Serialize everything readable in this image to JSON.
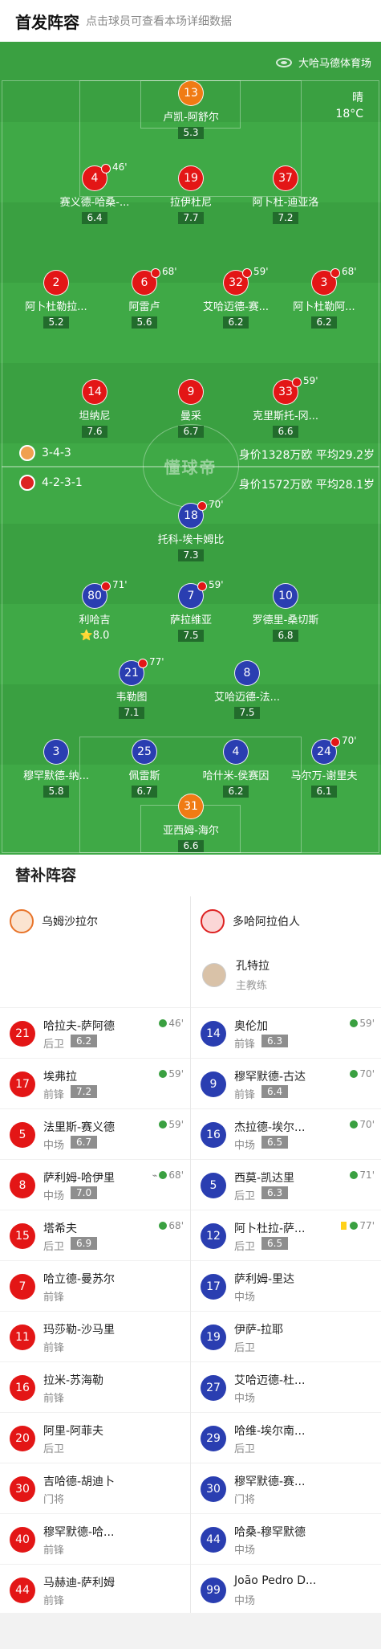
{
  "header": {
    "title": "首发阵容",
    "hint": "点击球员可查看本场详细数据"
  },
  "match": {
    "venue": "大哈马德体育场",
    "weather": "晴",
    "temperature": "18°C"
  },
  "home": {
    "formation": "3-4-3",
    "stats": "身价1328万欧  平均29.2岁",
    "color": "#e31616",
    "players": [
      {
        "num": "13",
        "name": "卢凯-阿舒尔",
        "rating": "5.3",
        "keeper": true
      },
      {
        "num": "4",
        "name": "赛义德-哈桑-...",
        "rating": "6.4",
        "sub": "46'"
      },
      {
        "num": "19",
        "name": "拉伊杜尼",
        "rating": "7.7",
        "ball": true
      },
      {
        "num": "37",
        "name": "阿卜杜-迪亚洛",
        "rating": "7.2"
      },
      {
        "num": "2",
        "name": "阿卜杜勒拉...",
        "rating": "5.2",
        "red": true
      },
      {
        "num": "6",
        "name": "阿雷卢",
        "rating": "5.6",
        "sub": "68'"
      },
      {
        "num": "32",
        "name": "艾哈迈德-赛...",
        "rating": "6.2",
        "sub": "59'"
      },
      {
        "num": "3",
        "name": "阿卜杜勒阿...",
        "rating": "6.2",
        "sub": "68'"
      },
      {
        "num": "14",
        "name": "坦纳尼",
        "rating": "7.6",
        "yellow": true,
        "captain": "C"
      },
      {
        "num": "9",
        "name": "曼采",
        "rating": "6.7",
        "ball": true
      },
      {
        "num": "33",
        "name": "克里斯托-冈...",
        "rating": "6.6",
        "sub": "59'"
      }
    ]
  },
  "away": {
    "formation": "4-2-3-1",
    "stats": "身价1572万欧  平均28.1岁",
    "color": "#2a3eb1",
    "players": [
      {
        "num": "18",
        "name": "托科-埃卡姆比",
        "rating": "7.3",
        "sub": "70'"
      },
      {
        "num": "80",
        "name": "利哈吉",
        "rating": "8.0",
        "sub": "71'",
        "best": true
      },
      {
        "num": "7",
        "name": "萨拉维亚",
        "rating": "7.5",
        "sub": "59'"
      },
      {
        "num": "10",
        "name": "罗德里-桑切斯",
        "rating": "6.8"
      },
      {
        "num": "21",
        "name": "韦勒图",
        "rating": "7.1",
        "sub": "77'"
      },
      {
        "num": "8",
        "name": "艾哈迈德-法...",
        "rating": "7.5",
        "captain": "C"
      },
      {
        "num": "3",
        "name": "穆罕默德-纳...",
        "rating": "5.8",
        "yellow": true
      },
      {
        "num": "25",
        "name": "佩雷斯",
        "rating": "6.7"
      },
      {
        "num": "4",
        "name": "哈什米-侯赛因",
        "rating": "6.2",
        "red": true
      },
      {
        "num": "24",
        "name": "马尔万-谢里夫",
        "rating": "6.1",
        "sub": "70'"
      },
      {
        "num": "31",
        "name": "亚西姆-海尔",
        "rating": "6.6",
        "keeper": true
      }
    ]
  },
  "center_logo": "懂球帝",
  "subs": {
    "title": "替补阵容",
    "home_team": "乌姆沙拉尔",
    "away_team": "多哈阿拉伯人",
    "coach": {
      "name": "孔特拉",
      "role": "主教练"
    },
    "home": [
      {
        "num": "21",
        "name": "哈拉夫-萨阿德",
        "pos": "后卫",
        "rating": "6.2",
        "time": "46'"
      },
      {
        "num": "17",
        "name": "埃弗拉",
        "pos": "前锋",
        "rating": "7.2",
        "time": "59'"
      },
      {
        "num": "5",
        "name": "法里斯-赛义德",
        "pos": "中场",
        "rating": "6.7",
        "time": "59'"
      },
      {
        "num": "8",
        "name": "萨利姆-哈伊里",
        "pos": "中场",
        "rating": "7.0",
        "time": "68'",
        "boot": true
      },
      {
        "num": "15",
        "name": "塔希夫",
        "pos": "后卫",
        "rating": "6.9",
        "time": "68'"
      },
      {
        "num": "7",
        "name": "哈立德-曼苏尔",
        "pos": "前锋"
      },
      {
        "num": "11",
        "name": "玛莎勒-沙马里",
        "pos": "前锋"
      },
      {
        "num": "16",
        "name": "拉米-苏海勒",
        "pos": "前锋"
      },
      {
        "num": "20",
        "name": "阿里-阿菲夫",
        "pos": "后卫"
      },
      {
        "num": "30",
        "name": "吉哈德-胡迪卜",
        "pos": "门将"
      },
      {
        "num": "40",
        "name": "穆罕默德-哈...",
        "pos": "前锋"
      },
      {
        "num": "44",
        "name": "马赫迪-萨利姆",
        "pos": "前锋"
      }
    ],
    "away": [
      {
        "num": "14",
        "name": "奥伦加",
        "pos": "前锋",
        "rating": "6.3",
        "time": "59'"
      },
      {
        "num": "9",
        "name": "穆罕默德-古达",
        "pos": "前锋",
        "rating": "6.4",
        "time": "70'"
      },
      {
        "num": "16",
        "name": "杰拉德-埃尔...",
        "pos": "中场",
        "rating": "6.5",
        "time": "70'"
      },
      {
        "num": "5",
        "name": "西莫-凯达里",
        "pos": "后卫",
        "rating": "6.3",
        "time": "71'"
      },
      {
        "num": "12",
        "name": "阿卜杜拉-萨...",
        "pos": "后卫",
        "rating": "6.5",
        "time": "77'",
        "yellow": true
      },
      {
        "num": "17",
        "name": "萨利姆-里达",
        "pos": "中场"
      },
      {
        "num": "19",
        "name": "伊萨-拉耶",
        "pos": "后卫"
      },
      {
        "num": "27",
        "name": "艾哈迈德-杜...",
        "pos": "中场"
      },
      {
        "num": "29",
        "name": "哈维-埃尔南...",
        "pos": "后卫"
      },
      {
        "num": "30",
        "name": "穆罕默德-赛...",
        "pos": "门将"
      },
      {
        "num": "44",
        "name": "哈桑-穆罕默德",
        "pos": "中场"
      },
      {
        "num": "99",
        "name": "João Pedro D...",
        "pos": "中场"
      }
    ]
  }
}
